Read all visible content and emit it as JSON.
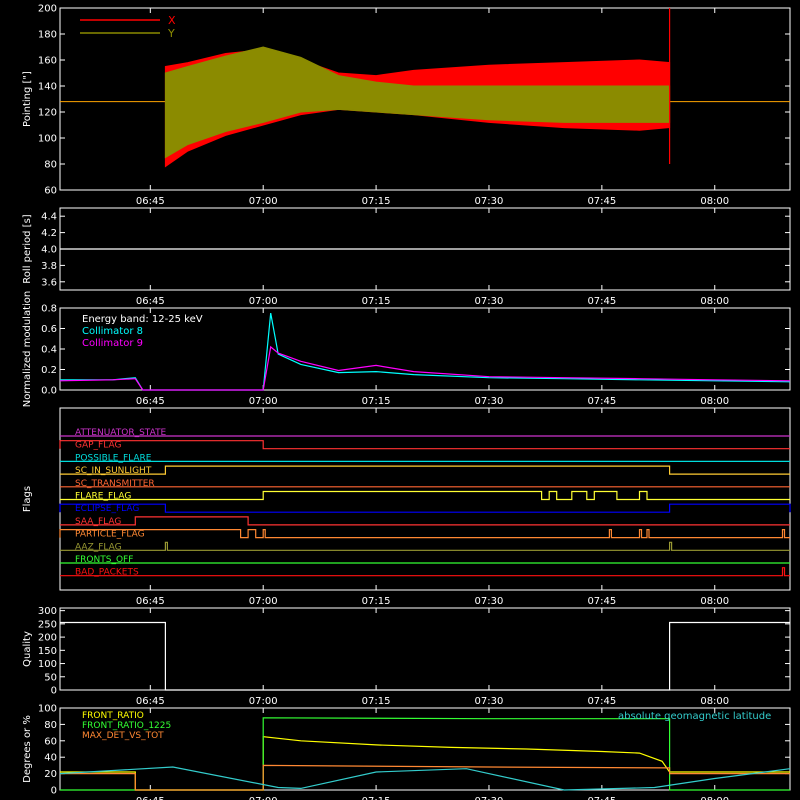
{
  "chart_data": [
    {
      "type": "line",
      "ylabel": "Pointing [\"]",
      "ylim": [
        60,
        200
      ],
      "yticks": [
        60,
        80,
        100,
        120,
        140,
        160,
        180,
        200
      ],
      "xticks": [
        "06:45",
        "07:00",
        "07:15",
        "07:30",
        "07:45",
        "08:00"
      ],
      "xlim": [
        "06:33",
        "08:10"
      ],
      "baseline": 128,
      "active_interval": [
        "06:47",
        "07:54"
      ],
      "series": [
        {
          "name": "X",
          "color": "#ff0000",
          "x": [
            "06:47",
            "06:50",
            "06:55",
            "07:00",
            "07:05",
            "07:10",
            "07:15",
            "07:20",
            "07:30",
            "07:40",
            "07:50",
            "07:54"
          ],
          "upper": [
            155,
            158,
            165,
            168,
            160,
            150,
            148,
            152,
            156,
            158,
            160,
            158
          ],
          "lower": [
            78,
            90,
            102,
            110,
            118,
            122,
            120,
            118,
            112,
            108,
            106,
            108
          ]
        },
        {
          "name": "Y",
          "color": "#8b8b00",
          "x": [
            "06:47",
            "06:50",
            "06:55",
            "07:00",
            "07:05",
            "07:10",
            "07:15",
            "07:20",
            "07:30",
            "07:40",
            "07:50",
            "07:54"
          ],
          "upper": [
            150,
            155,
            163,
            170,
            162,
            148,
            143,
            140,
            140,
            140,
            140,
            140
          ],
          "lower": [
            85,
            95,
            105,
            112,
            120,
            122,
            120,
            118,
            114,
            112,
            112,
            112
          ]
        }
      ]
    },
    {
      "type": "line",
      "ylabel": "Roll period [s]",
      "ylim": [
        3.5,
        4.5
      ],
      "yticks": [
        3.6,
        3.8,
        4.0,
        4.2,
        4.4
      ],
      "xticks": [
        "06:45",
        "07:00",
        "07:15",
        "07:30",
        "07:45",
        "08:00"
      ],
      "series": [
        {
          "name": "",
          "color": "#ffffff",
          "x": [
            "06:33",
            "08:10"
          ],
          "values": [
            4.0,
            4.0
          ]
        }
      ]
    },
    {
      "type": "line",
      "ylabel": "Normalized modulation",
      "ylim": [
        0,
        0.8
      ],
      "yticks": [
        0.0,
        0.2,
        0.4,
        0.6,
        0.8
      ],
      "xticks": [
        "06:45",
        "07:00",
        "07:15",
        "07:30",
        "07:45",
        "08:00"
      ],
      "legend_title": "Energy band: 12-25 keV",
      "series": [
        {
          "name": "Collimator 8",
          "color": "#00ffff",
          "x": [
            "06:33",
            "06:40",
            "06:43",
            "06:44",
            "07:00",
            "07:01",
            "07:02",
            "07:05",
            "07:10",
            "07:15",
            "07:20",
            "07:30",
            "07:40",
            "07:50",
            "08:00",
            "08:10"
          ],
          "values": [
            0.1,
            0.1,
            0.12,
            0.0,
            0.0,
            0.75,
            0.35,
            0.25,
            0.17,
            0.18,
            0.15,
            0.12,
            0.11,
            0.1,
            0.09,
            0.08
          ]
        },
        {
          "name": "Collimator 9",
          "color": "#ff00ff",
          "x": [
            "06:33",
            "06:40",
            "06:43",
            "06:44",
            "07:00",
            "07:01",
            "07:02",
            "07:05",
            "07:10",
            "07:15",
            "07:20",
            "07:30",
            "07:40",
            "07:50",
            "08:00",
            "08:10"
          ],
          "values": [
            0.09,
            0.1,
            0.11,
            0.0,
            0.0,
            0.42,
            0.36,
            0.28,
            0.19,
            0.24,
            0.18,
            0.13,
            0.12,
            0.11,
            0.1,
            0.09
          ]
        }
      ]
    },
    {
      "type": "line",
      "ylabel": "Flags",
      "xticks": [
        "06:45",
        "07:00",
        "07:15",
        "07:30",
        "07:45",
        "08:00"
      ],
      "flags": [
        {
          "name": "ATTENUATOR_STATE",
          "color": "#cc33cc",
          "on": []
        },
        {
          "name": "GAP_FLAG",
          "color": "#ff3333",
          "on": [
            [
              "06:33",
              "07:00"
            ]
          ]
        },
        {
          "name": "POSSIBLE_FLARE",
          "color": "#00dddd",
          "on": []
        },
        {
          "name": "SC_IN_SUNLIGHT",
          "color": "#ffcc33",
          "on": [
            [
              "06:47",
              "07:54"
            ]
          ]
        },
        {
          "name": "SC_TRANSMITTER",
          "color": "#ff6633",
          "on": []
        },
        {
          "name": "FLARE_FLAG",
          "color": "#ffff33",
          "on": [
            [
              "07:00",
              "07:37"
            ],
            [
              "07:38",
              "07:39"
            ],
            [
              "07:41",
              "07:43"
            ],
            [
              "07:44",
              "07:47"
            ],
            [
              "07:50",
              "07:51"
            ]
          ]
        },
        {
          "name": "ECLIPSE_FLAG",
          "color": "#0000ff",
          "on": [
            [
              "06:33",
              "06:47"
            ],
            [
              "07:54",
              "08:10"
            ]
          ]
        },
        {
          "name": "SAA_FLAG",
          "color": "#ff3333",
          "on": [
            [
              "06:43",
              "06:58"
            ]
          ]
        },
        {
          "name": "PARTICLE_FLAG",
          "color": "#ff8833",
          "on": [
            [
              "06:33",
              "06:57"
            ],
            [
              "06:58",
              "06:59"
            ],
            [
              "07:00",
              "07:00"
            ],
            [
              "07:46",
              "07:46"
            ],
            [
              "07:50",
              "07:50"
            ],
            [
              "07:51",
              "07:51"
            ],
            [
              "08:09",
              "08:09"
            ]
          ]
        },
        {
          "name": "AAZ_FLAG",
          "color": "#999933",
          "on": [
            [
              "06:47",
              "06:47"
            ],
            [
              "07:54",
              "07:54"
            ]
          ]
        },
        {
          "name": "FRONTS_OFF",
          "color": "#33ff33",
          "on": []
        },
        {
          "name": "BAD_PACKETS",
          "color": "#ff1111",
          "on": [
            [
              "08:09",
              "08:09"
            ]
          ]
        }
      ]
    },
    {
      "type": "line",
      "ylabel": "Quality",
      "ylim": [
        0,
        310
      ],
      "yticks": [
        0,
        50,
        100,
        150,
        200,
        250,
        300
      ],
      "xticks": [
        "06:45",
        "07:00",
        "07:15",
        "07:30",
        "07:45",
        "08:00"
      ],
      "series": [
        {
          "name": "",
          "color": "#ffffff",
          "x": [
            "06:33",
            "06:47",
            "06:47",
            "07:54",
            "07:54",
            "08:10"
          ],
          "values": [
            255,
            255,
            0,
            0,
            255,
            255
          ]
        }
      ]
    },
    {
      "type": "line",
      "ylabel": "Degrees or %",
      "ylim": [
        0,
        100
      ],
      "yticks": [
        0,
        20,
        40,
        60,
        80,
        100
      ],
      "xticks": [
        "06:45",
        "07:00",
        "07:15",
        "07:30",
        "07:45",
        "08:00"
      ],
      "series": [
        {
          "name": "FRONT_RATIO",
          "color": "#ffff00",
          "x": [
            "06:33",
            "06:43",
            "06:43",
            "07:00",
            "07:00",
            "07:05",
            "07:15",
            "07:25",
            "07:35",
            "07:45",
            "07:50",
            "07:53",
            "07:54",
            "08:10"
          ],
          "values": [
            22,
            22,
            0,
            0,
            65,
            60,
            55,
            52,
            50,
            47,
            45,
            35,
            22,
            22
          ]
        },
        {
          "name": "FRONT_RATIO_1225",
          "color": "#33ff33",
          "x": [
            "06:33",
            "06:43",
            "06:43",
            "07:00",
            "07:00",
            "07:30",
            "07:54",
            "07:54",
            "08:10"
          ],
          "values": [
            0,
            0,
            0,
            0,
            88,
            87,
            87,
            0,
            0
          ]
        },
        {
          "name": "MAX_DET_VS_TOT",
          "color": "#ff8833",
          "x": [
            "06:33",
            "06:43",
            "06:43",
            "07:00",
            "07:00",
            "07:30",
            "07:54",
            "07:54",
            "08:10"
          ],
          "values": [
            20,
            20,
            0,
            0,
            30,
            28,
            27,
            20,
            20
          ]
        },
        {
          "name": "absolute geomagnetic latitude",
          "color": "#33cccc",
          "x": [
            "06:33",
            "06:48",
            "07:02",
            "07:05",
            "07:15",
            "07:27",
            "07:40",
            "07:52",
            "08:00",
            "08:10"
          ],
          "values": [
            20,
            28,
            3,
            2,
            22,
            26,
            0,
            3,
            14,
            26
          ]
        }
      ]
    }
  ]
}
